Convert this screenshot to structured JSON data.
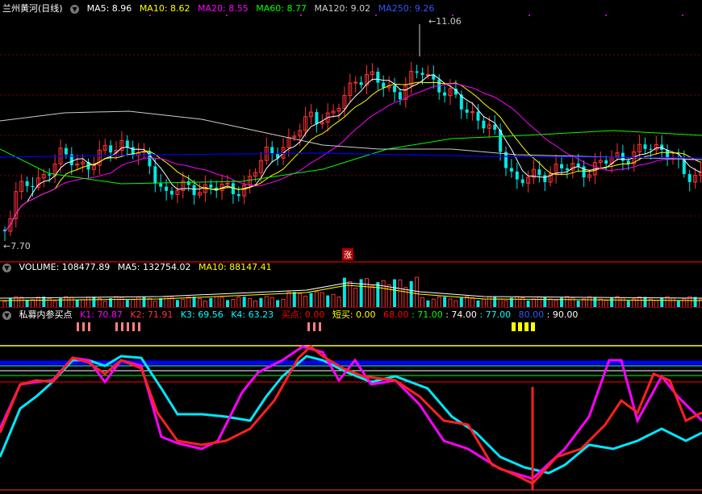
{
  "price_pane": {
    "title": "兰州黄河(日线)",
    "ma_labels": [
      {
        "text": "MA5: 8.96",
        "color": "#ffffff"
      },
      {
        "text": "MA10: 8.62",
        "color": "#ffff00"
      },
      {
        "text": "MA20: 8.55",
        "color": "#ff00ff"
      },
      {
        "text": "MA60: 8.77",
        "color": "#00ff00"
      },
      {
        "text": "MA120: 9.02",
        "color": "#cccccc"
      },
      {
        "text": "MA250: 9.26",
        "color": "#0000ff"
      }
    ],
    "high_label": "11.06",
    "low_label": "7.70",
    "marker_label": "涨"
  },
  "volume_pane": {
    "labels": [
      {
        "text": "VOLUME: 108477.89",
        "color": "#ffffff"
      },
      {
        "text": "MA5: 132754.02",
        "color": "#ffffff"
      },
      {
        "text": "MA10: 88147.41",
        "color": "#ffff00"
      }
    ]
  },
  "indicator_pane": {
    "title": "私募内参买点",
    "labels": [
      {
        "text": "K1: 70.87",
        "color": "#ff00ff"
      },
      {
        "text": "K2: 71.91",
        "color": "#ff3333"
      },
      {
        "text": "K3: 69.56",
        "color": "#00ffff"
      },
      {
        "text": "K4: 63.23",
        "color": "#00ffff"
      },
      {
        "text": "买点: 0.00",
        "color": "#ff0000"
      },
      {
        "text": "短买: 0.00",
        "color": "#ffff00"
      },
      {
        "text": "68.00",
        "color": "#ff0000"
      },
      {
        "text": ": 71.00",
        "color": "#00ff00"
      },
      {
        "text": ": 74.00",
        "color": "#ffffff"
      },
      {
        "text": ": 77.00",
        "color": "#00ffff"
      },
      {
        "text": "80.00",
        "color": "#0000ff"
      },
      {
        "text": ": 90.00",
        "color": "#ffffff"
      }
    ]
  },
  "colors": {
    "up": "#ff3232",
    "down": "#00e8e8",
    "ma5": "#ffffff",
    "ma10": "#ffff00",
    "ma20": "#ff00ff",
    "ma60": "#00ff00",
    "ma120": "#cccccc",
    "ma250": "#0000ff"
  }
}
